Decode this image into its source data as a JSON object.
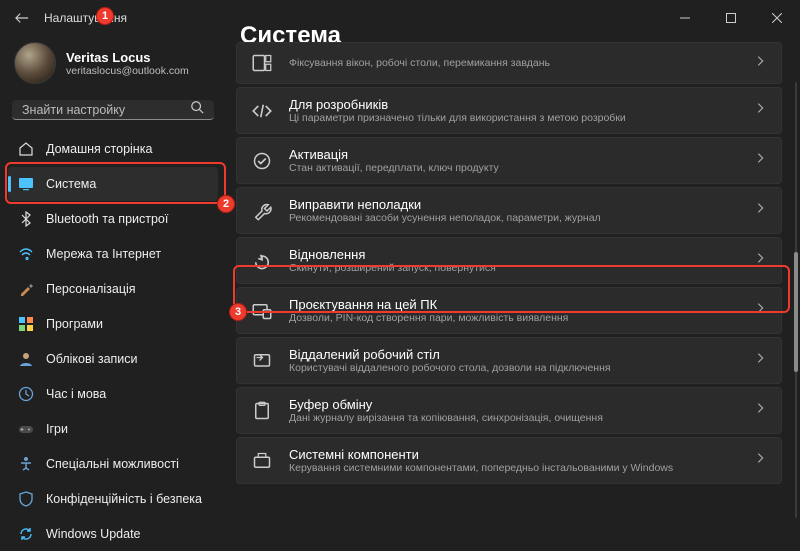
{
  "window": {
    "title": "Налаштування"
  },
  "profile": {
    "name": "Veritas Locus",
    "email": "veritaslocus@outlook.com"
  },
  "search": {
    "placeholder": "Знайти настройку"
  },
  "nav": [
    {
      "label": "Домашня сторінка",
      "icon": "home"
    },
    {
      "label": "Система",
      "icon": "system",
      "active": true
    },
    {
      "label": "Bluetooth та пристрої",
      "icon": "bluetooth"
    },
    {
      "label": "Мережа та Інтернет",
      "icon": "wifi"
    },
    {
      "label": "Персоналізація",
      "icon": "brush"
    },
    {
      "label": "Програми",
      "icon": "apps"
    },
    {
      "label": "Облікові записи",
      "icon": "account"
    },
    {
      "label": "Час і мова",
      "icon": "time"
    },
    {
      "label": "Ігри",
      "icon": "games"
    },
    {
      "label": "Спеціальні можливості",
      "icon": "access"
    },
    {
      "label": "Конфіденційність і безпека",
      "icon": "privacy"
    },
    {
      "label": "Windows Update",
      "icon": "update"
    }
  ],
  "main": {
    "heading": "Система",
    "items": [
      {
        "title": "",
        "sub": "Фіксування вікон, робочі столи, перемикання завдань",
        "icon": "multitask",
        "cut": true
      },
      {
        "title": "Для розробників",
        "sub": "Ці параметри призначено тільки для використання з метою розробки",
        "icon": "dev"
      },
      {
        "title": "Активація",
        "sub": "Стан активації, передплати, ключ продукту",
        "icon": "activation"
      },
      {
        "title": "Виправити неполадки",
        "sub": "Рекомендовані засоби усунення неполадок, параметри, журнал",
        "icon": "troubleshoot"
      },
      {
        "title": "Відновлення",
        "sub": "Скинути, розширений запуск, повернутися",
        "icon": "recovery"
      },
      {
        "title": "Проєктування на цей ПК",
        "sub": "Дозволи, PIN-код створення пари, можливість виявлення",
        "icon": "project"
      },
      {
        "title": "Віддалений робочий стіл",
        "sub": "Користувачі віддаленого робочого стола, дозволи на підключення",
        "icon": "remote"
      },
      {
        "title": "Буфер обміну",
        "sub": "Дані журналу вирізання та копіювання, синхронізація, очищення",
        "icon": "clipboard"
      },
      {
        "title": "Системні компоненти",
        "sub": "Керування системними компонентами, попередньо інстальованими у Windows",
        "icon": "components"
      }
    ]
  },
  "badges": {
    "b1": "1",
    "b2": "2",
    "b3": "3"
  }
}
